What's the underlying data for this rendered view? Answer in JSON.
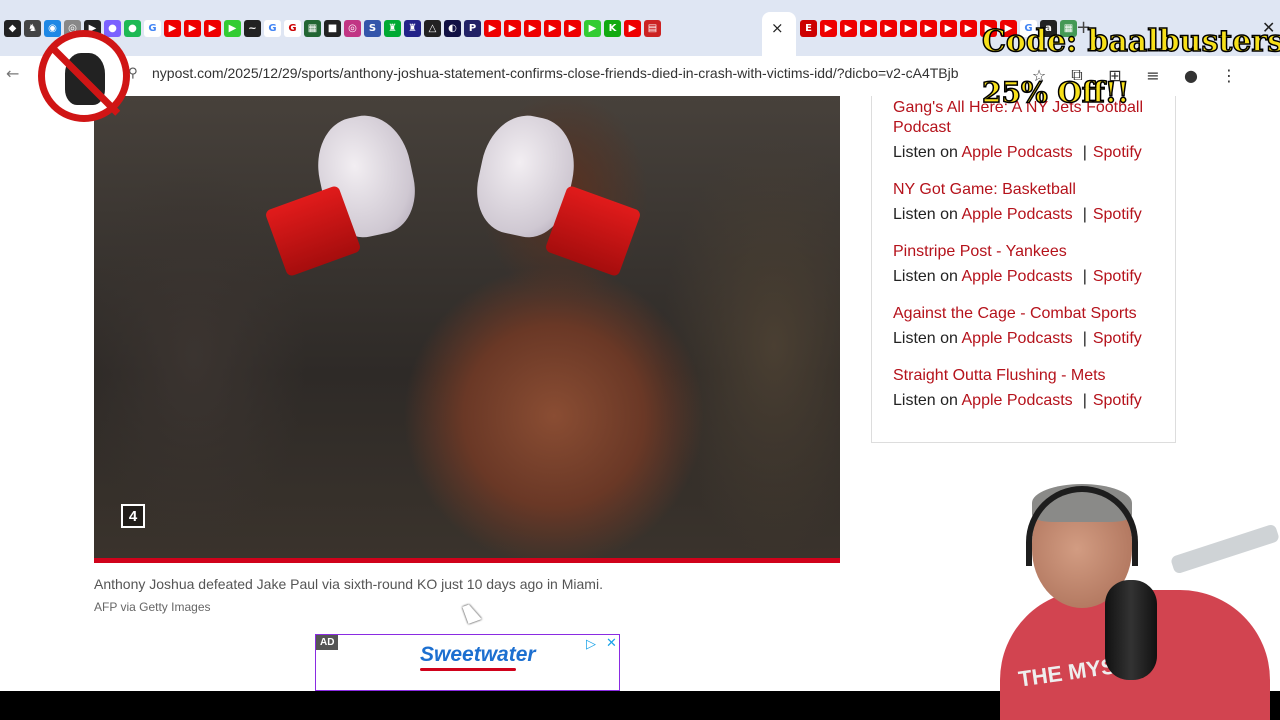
{
  "browser": {
    "url": "nypost.com/2025/12/29/sports/anthony-joshua-statement-confirms-close-friends-died-in-crash-with-victims-idd/?dicbo=v2-cA4TBjb",
    "tab_close": "×",
    "new_tab": "+",
    "window_close": "✕",
    "back": "←",
    "site_info": "⚲"
  },
  "article": {
    "photo_badge": "4",
    "caption": "Anthony Joshua defeated Jake Paul via sixth-round KO just 10 days ago in Miami.",
    "credit": "AFP via Getty Images",
    "photo_alt": "Anthony Joshua in boxing gloves"
  },
  "ad": {
    "label": "AD",
    "brand": "Sweetwater",
    "close": "✕",
    "choices": "▷"
  },
  "sidebar": {
    "podcasts": [
      {
        "title": "Gang's All Here: A NY Jets Football Podcast",
        "listen": "Listen on",
        "apple": "Apple Podcasts",
        "sep": "|",
        "spotify": "Spotify"
      },
      {
        "title": "NY Got Game: Basketball",
        "listen": "Listen on",
        "apple": "Apple Podcasts",
        "sep": "|",
        "spotify": "Spotify"
      },
      {
        "title": "Pinstripe Post - Yankees",
        "listen": "Listen on",
        "apple": "Apple Podcasts",
        "sep": "|",
        "spotify": "Spotify"
      },
      {
        "title": "Against the Cage - Combat Sports",
        "listen": "Listen on",
        "apple": "Apple Podcasts",
        "sep": "|",
        "spotify": "Spotify"
      },
      {
        "title": "Straight Outta Flushing - Mets",
        "listen": "Listen on",
        "apple": "Apple Podcasts",
        "sep": "|",
        "spotify": "Spotify"
      }
    ]
  },
  "overlay": {
    "promo_code": "Code: baalbusters",
    "promo_off": "25% Off!!",
    "shirt_text": "THE MYSTE"
  },
  "colors": {
    "link": "#b5121b",
    "accent_red": "#d0021b",
    "promo_yellow": "#f7e01a"
  }
}
